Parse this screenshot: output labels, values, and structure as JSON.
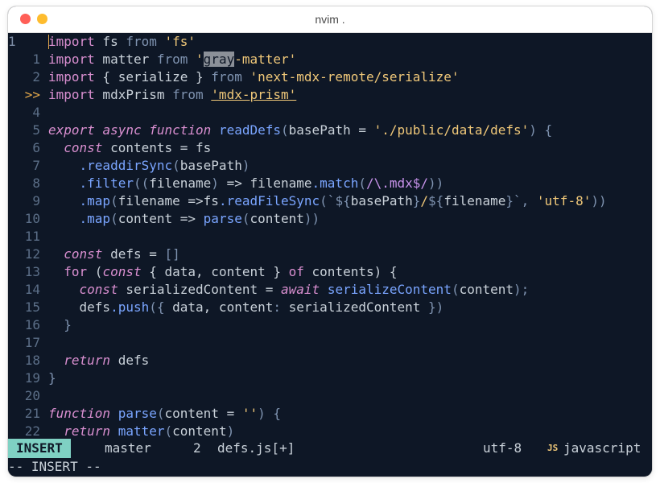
{
  "window": {
    "title": "nvim ."
  },
  "editor": {
    "lines": [
      {
        "num": "1",
        "numStyle": "current",
        "tokens": [
          {
            "t": "import",
            "c": "kw"
          },
          {
            "t": " fs "
          },
          {
            "t": "from",
            "c": "dim"
          },
          {
            "t": " "
          },
          {
            "t": "'fs'",
            "c": "str"
          }
        ]
      },
      {
        "num": "1",
        "tokens": [
          {
            "t": "import",
            "c": "kw"
          },
          {
            "t": " matter "
          },
          {
            "t": "from",
            "c": "dim"
          },
          {
            "t": " "
          },
          {
            "t": "'",
            "c": "str"
          },
          {
            "t": "gray",
            "c": "sel"
          },
          {
            "t": "-matter'",
            "c": "str"
          }
        ]
      },
      {
        "num": "2",
        "tokens": [
          {
            "t": "import",
            "c": "kw"
          },
          {
            "t": " { serialize } "
          },
          {
            "t": "from",
            "c": "dim"
          },
          {
            "t": " "
          },
          {
            "t": "'next-mdx-remote/serialize'",
            "c": "str"
          }
        ]
      },
      {
        "num": ">>",
        "numStyle": "marker",
        "tokens": [
          {
            "t": "import",
            "c": "kw"
          },
          {
            "t": " mdxPrism "
          },
          {
            "t": "from",
            "c": "dim"
          },
          {
            "t": " "
          },
          {
            "t": "'mdx-prism'",
            "c": "str under"
          }
        ]
      },
      {
        "num": "4",
        "tokens": []
      },
      {
        "num": "5",
        "tokens": [
          {
            "t": "export",
            "c": "kwi"
          },
          {
            "t": " "
          },
          {
            "t": "async",
            "c": "kwi"
          },
          {
            "t": " "
          },
          {
            "t": "function",
            "c": "kwi"
          },
          {
            "t": " "
          },
          {
            "t": "readDefs",
            "c": "fn"
          },
          {
            "t": "(",
            "c": "dim"
          },
          {
            "t": "basePath = "
          },
          {
            "t": "'./public/data/defs'",
            "c": "str"
          },
          {
            "t": ") {",
            "c": "dim"
          }
        ]
      },
      {
        "num": "6",
        "tokens": [
          {
            "t": "  "
          },
          {
            "t": "const",
            "c": "kwi"
          },
          {
            "t": " contents = fs"
          }
        ]
      },
      {
        "num": "7",
        "tokens": [
          {
            "t": "    "
          },
          {
            "t": ".readdirSync",
            "c": "fn"
          },
          {
            "t": "(",
            "c": "dim"
          },
          {
            "t": "basePath"
          },
          {
            "t": ")",
            "c": "dim"
          }
        ]
      },
      {
        "num": "8",
        "tokens": [
          {
            "t": "    "
          },
          {
            "t": ".filter",
            "c": "fn"
          },
          {
            "t": "((",
            "c": "dim"
          },
          {
            "t": "filename"
          },
          {
            "t": ")",
            "c": "dim"
          },
          {
            "t": " => filename"
          },
          {
            "t": ".match",
            "c": "fn"
          },
          {
            "t": "(",
            "c": "dim"
          },
          {
            "t": "/\\.mdx$/",
            "c": "rx"
          },
          {
            "t": "))",
            "c": "dim"
          }
        ]
      },
      {
        "num": "9",
        "tokens": [
          {
            "t": "    "
          },
          {
            "t": ".map",
            "c": "fn"
          },
          {
            "t": "(",
            "c": "dim"
          },
          {
            "t": "filename =>fs"
          },
          {
            "t": ".readFileSync",
            "c": "fn"
          },
          {
            "t": "(`${",
            "c": "dim"
          },
          {
            "t": "basePath"
          },
          {
            "t": "}",
            "c": "dim"
          },
          {
            "t": "/",
            "c": "str"
          },
          {
            "t": "${",
            "c": "dim"
          },
          {
            "t": "filename"
          },
          {
            "t": "}`, ",
            "c": "dim"
          },
          {
            "t": "'utf-8'",
            "c": "str"
          },
          {
            "t": "))",
            "c": "dim"
          }
        ]
      },
      {
        "num": "10",
        "tokens": [
          {
            "t": "    "
          },
          {
            "t": ".map",
            "c": "fn"
          },
          {
            "t": "(",
            "c": "dim"
          },
          {
            "t": "content => "
          },
          {
            "t": "parse",
            "c": "fn"
          },
          {
            "t": "(",
            "c": "dim"
          },
          {
            "t": "content"
          },
          {
            "t": "))",
            "c": "dim"
          }
        ]
      },
      {
        "num": "11",
        "tokens": []
      },
      {
        "num": "12",
        "tokens": [
          {
            "t": "  "
          },
          {
            "t": "const",
            "c": "kwi"
          },
          {
            "t": " defs = "
          },
          {
            "t": "[]",
            "c": "dim"
          }
        ]
      },
      {
        "num": "13",
        "tokens": [
          {
            "t": "  "
          },
          {
            "t": "for",
            "c": "kw"
          },
          {
            "t": " ("
          },
          {
            "t": "const",
            "c": "kwi"
          },
          {
            "t": " { data, content } "
          },
          {
            "t": "of",
            "c": "kw"
          },
          {
            "t": " contents) {",
            "c": ""
          }
        ]
      },
      {
        "num": "14",
        "tokens": [
          {
            "t": "    "
          },
          {
            "t": "const",
            "c": "kwi"
          },
          {
            "t": " serializedContent = "
          },
          {
            "t": "await",
            "c": "kwi"
          },
          {
            "t": " "
          },
          {
            "t": "serializeContent",
            "c": "fn"
          },
          {
            "t": "(",
            "c": "dim"
          },
          {
            "t": "content"
          },
          {
            "t": ");",
            "c": "dim"
          }
        ]
      },
      {
        "num": "15",
        "tokens": [
          {
            "t": "    defs"
          },
          {
            "t": ".push",
            "c": "fn"
          },
          {
            "t": "({",
            "c": "dim"
          },
          {
            "t": " data, content"
          },
          {
            "t": ":",
            "c": "dim"
          },
          {
            "t": " serializedContent "
          },
          {
            "t": "})",
            "c": "dim"
          }
        ]
      },
      {
        "num": "16",
        "tokens": [
          {
            "t": "  "
          },
          {
            "t": "}",
            "c": "dim"
          }
        ]
      },
      {
        "num": "17",
        "tokens": []
      },
      {
        "num": "18",
        "tokens": [
          {
            "t": "  "
          },
          {
            "t": "return",
            "c": "kwi"
          },
          {
            "t": " defs"
          }
        ]
      },
      {
        "num": "19",
        "tokens": [
          {
            "t": "}",
            "c": "dim"
          }
        ]
      },
      {
        "num": "20",
        "tokens": []
      },
      {
        "num": "21",
        "tokens": [
          {
            "t": "function",
            "c": "kwi"
          },
          {
            "t": " "
          },
          {
            "t": "parse",
            "c": "fn"
          },
          {
            "t": "(",
            "c": "dim"
          },
          {
            "t": "content = "
          },
          {
            "t": "''",
            "c": "str"
          },
          {
            "t": ") {",
            "c": "dim"
          }
        ]
      },
      {
        "num": "22",
        "tokens": [
          {
            "t": "  "
          },
          {
            "t": "return",
            "c": "kwi"
          },
          {
            "t": " "
          },
          {
            "t": "matter",
            "c": "fn"
          },
          {
            "t": "(",
            "c": "dim"
          },
          {
            "t": "content"
          },
          {
            "t": ")",
            "c": "dim"
          }
        ]
      }
    ]
  },
  "statusline": {
    "mode": "INSERT",
    "branch_icon": "git-branch-icon",
    "branch": "master",
    "diagnostics_icon": "info-icon",
    "diagnostics": "2",
    "file": "defs.js[+]",
    "encoding": "utf-8",
    "filetype_icon_text": "JS",
    "filetype": "javascript"
  },
  "cmdline": {
    "text": "-- INSERT --"
  },
  "colors": {
    "background": "#0e1726",
    "mode_bg": "#7fd1c3",
    "keyword": "#d98fd0",
    "string": "#f0c879",
    "function": "#7aa5ff"
  }
}
